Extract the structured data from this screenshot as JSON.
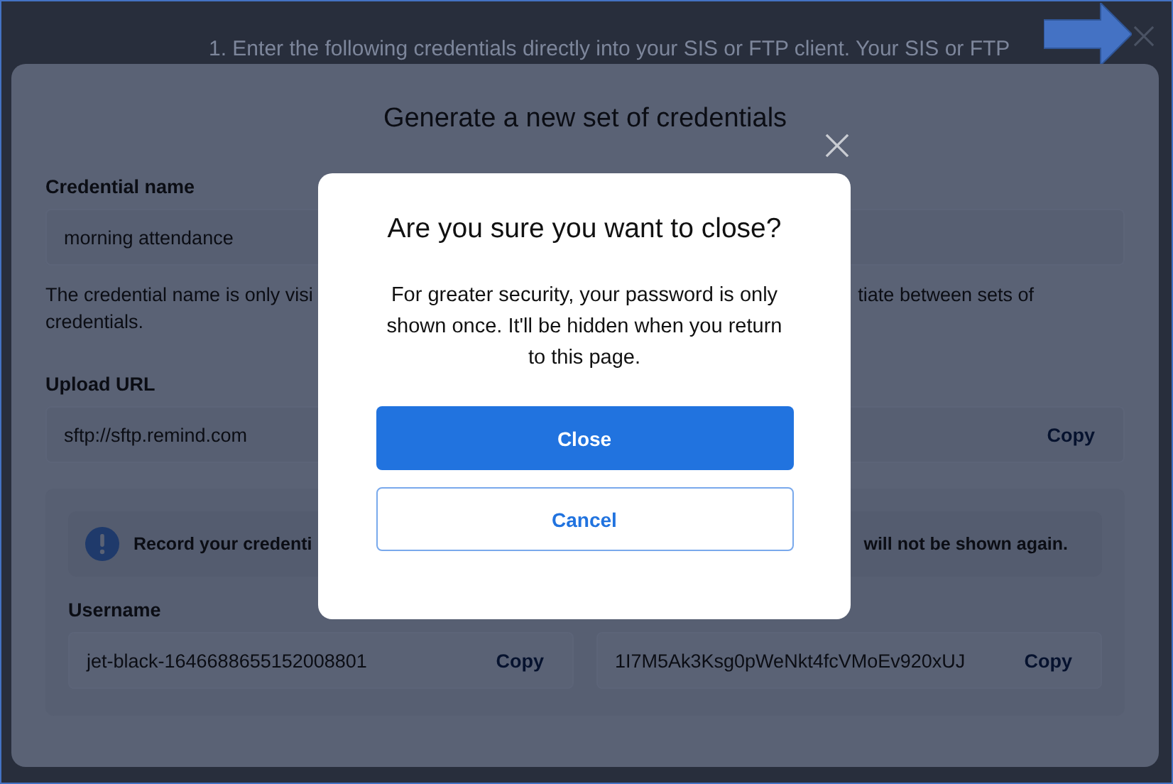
{
  "background_instruction": "1.   Enter the following credentials directly into your SIS or FTP client. Your SIS or FTP",
  "panel": {
    "title": "Generate a new set of credentials",
    "credential_name": {
      "label": "Credential name",
      "value": "morning attendance"
    },
    "help_text_start": "The credential name is only visi",
    "help_text_end": "tiate between sets of",
    "help_text_line2": "credentials.",
    "upload_url": {
      "label": "Upload URL",
      "value": "sftp://sftp.remind.com",
      "copy": "Copy"
    },
    "notice": {
      "start": "Record your credenti",
      "end": "will not be shown again."
    },
    "username": {
      "label": "Username",
      "value": "jet-black-1646688655152008801",
      "copy": "Copy"
    },
    "password": {
      "value": "1I7M5Ak3Ksg0pWeNkt4fcVMoEv920xUJ",
      "copy": "Copy"
    }
  },
  "dialog": {
    "title": "Are you sure you want to close?",
    "body": "For greater security, your password is only shown once. It'll be hidden when you return to this page.",
    "buttons": [
      {
        "label": "Close",
        "kind": "primary"
      },
      {
        "label": "Cancel",
        "kind": "secondary"
      }
    ]
  }
}
